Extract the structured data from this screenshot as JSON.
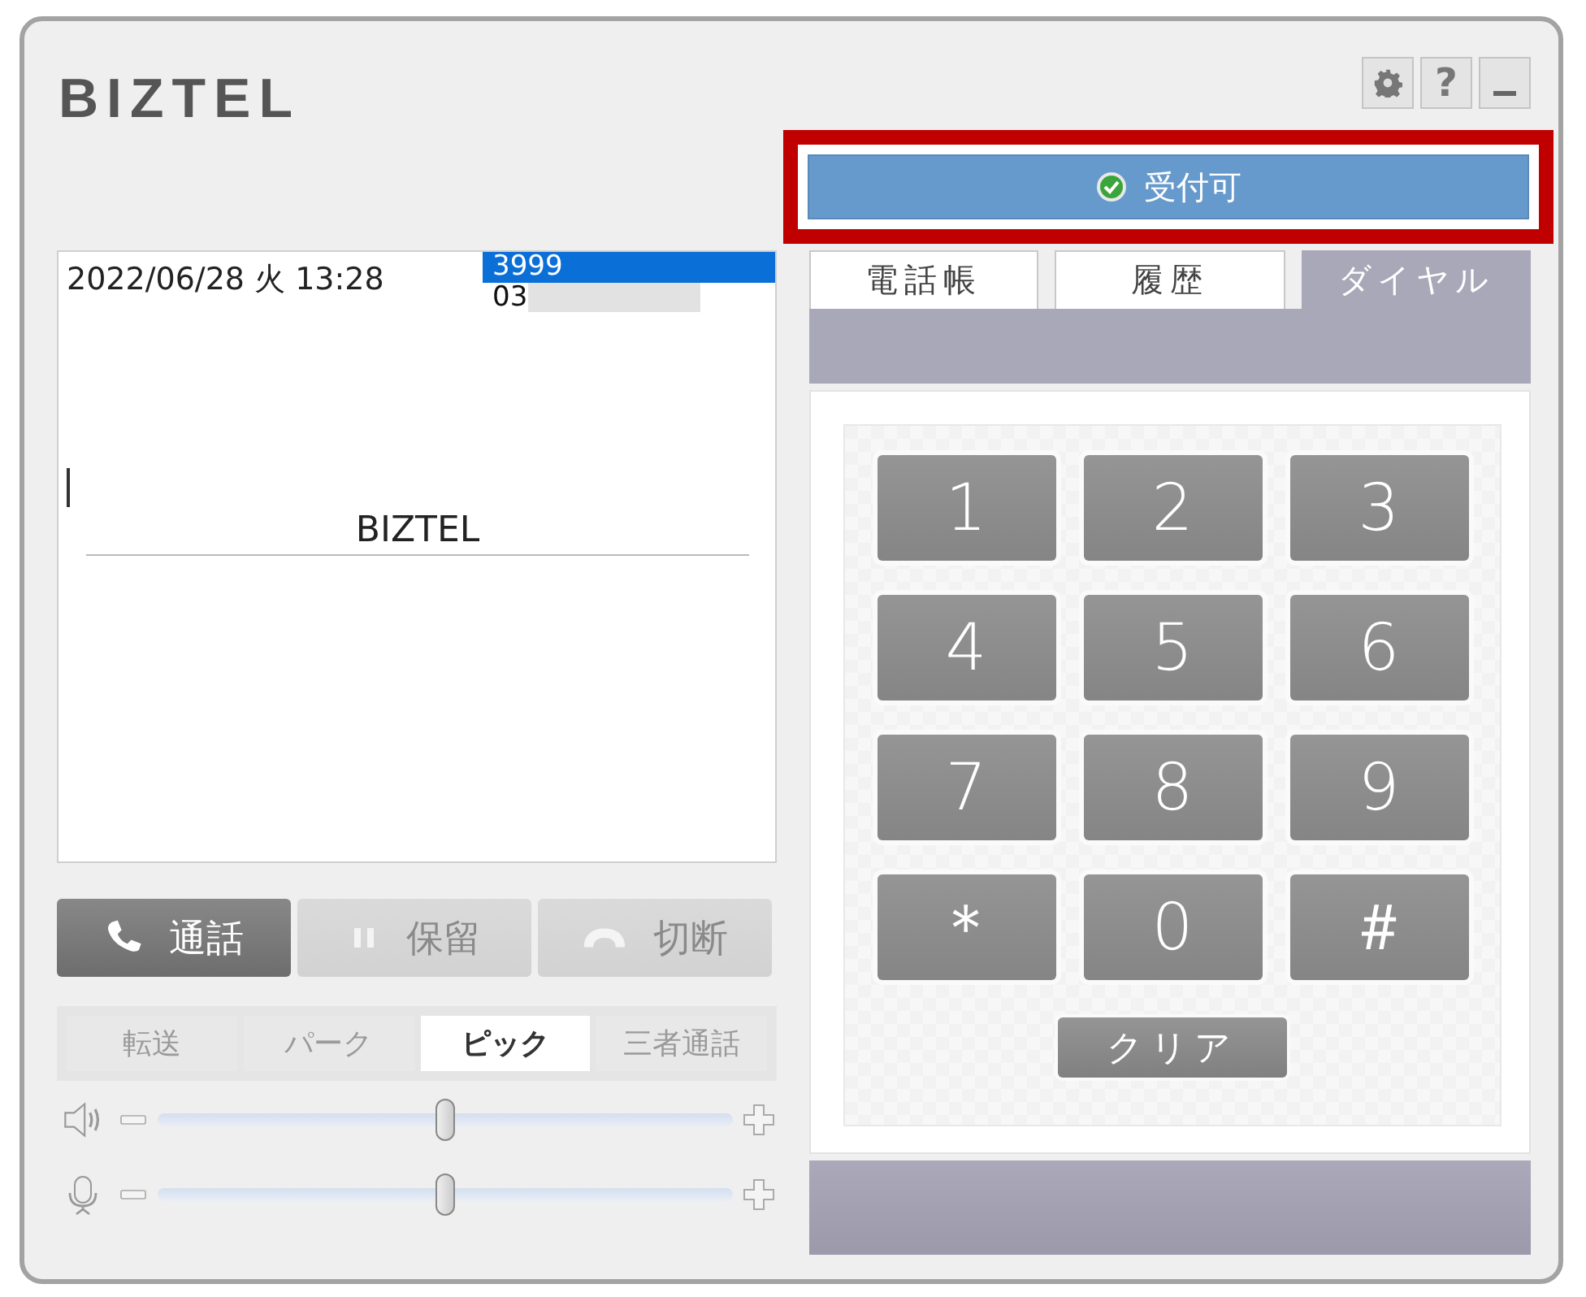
{
  "logo": "BIZTEL",
  "header_buttons": [
    {
      "kind": "settings"
    },
    {
      "kind": "help",
      "label": "?"
    },
    {
      "kind": "minimize"
    }
  ],
  "status": {
    "label": "受付可",
    "kind": "available",
    "highlighted": true
  },
  "call_info": {
    "datetime": "2022/06/28 火 13:28",
    "numbers": [
      {
        "text": "3999",
        "selected": true,
        "masked": false
      },
      {
        "text": "03",
        "selected": false,
        "masked": true
      }
    ],
    "name": "BIZTEL"
  },
  "call_buttons": [
    {
      "kind": "talk",
      "label": "通話",
      "disabled": false
    },
    {
      "kind": "hold",
      "label": "保留",
      "disabled": true
    },
    {
      "kind": "hangup",
      "label": "切断",
      "disabled": true
    }
  ],
  "call_tabs": [
    {
      "label": "転送",
      "selected": false,
      "disabled": true
    },
    {
      "label": "パーク",
      "selected": false,
      "disabled": true
    },
    {
      "label": "ピック",
      "selected": true,
      "disabled": false
    },
    {
      "label": "三者通話",
      "selected": false,
      "disabled": true
    }
  ],
  "volumes": [
    {
      "kind": "speaker",
      "level": 0.5
    },
    {
      "kind": "microphone",
      "level": 0.5
    }
  ],
  "tabs": [
    {
      "label": "電話帳",
      "selected": false
    },
    {
      "label": "履歴",
      "selected": false
    },
    {
      "label": "ダイヤル",
      "selected": true
    }
  ],
  "keypad": [
    "1",
    "2",
    "3",
    "4",
    "5",
    "6",
    "7",
    "8",
    "9",
    "＊",
    "0",
    "＃"
  ],
  "clear_button": "クリア"
}
